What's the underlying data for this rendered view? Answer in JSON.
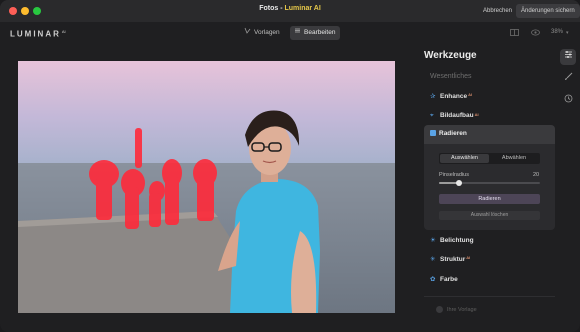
{
  "window": {
    "title_prefix": "Fotos",
    "title_sep": " - ",
    "title_app": "Luminar AI",
    "cancel_label": "Abbrechen",
    "save_label": "Änderungen sichern"
  },
  "toolbar": {
    "logo": "LUMINAR",
    "logo_sup": "AI",
    "tabs": [
      {
        "label": "Vorlagen",
        "icon": "templates-icon"
      },
      {
        "label": "Bearbeiten",
        "icon": "edit-sliders-icon",
        "active": true
      }
    ],
    "zoom": "38%"
  },
  "panel": {
    "title": "Werkzeuge",
    "section": "Wesentliches",
    "tools_top": [
      {
        "label": "Enhance",
        "badge": "AI"
      },
      {
        "label": "Bildaufbau",
        "badge": "AI"
      }
    ],
    "radieren": {
      "label": "Radieren",
      "segment_a": "Auswählen",
      "segment_b": "Abwählen",
      "brush_label": "Pinselradius",
      "brush_value": "20",
      "brush_fraction": 0.2,
      "erase_button": "Radieren",
      "clear_button": "Auswahl löschen"
    },
    "tools_bottom": [
      {
        "label": "Belichtung",
        "badge": ""
      },
      {
        "label": "Struktur",
        "badge": "AI"
      },
      {
        "label": "Farbe",
        "badge": ""
      }
    ],
    "preset": "Ihre Vorlage"
  },
  "colors": {
    "accent_blue": "#5aa3e6",
    "erase_mask": "#ff2a3a",
    "shirt": "#3fb6e0"
  }
}
